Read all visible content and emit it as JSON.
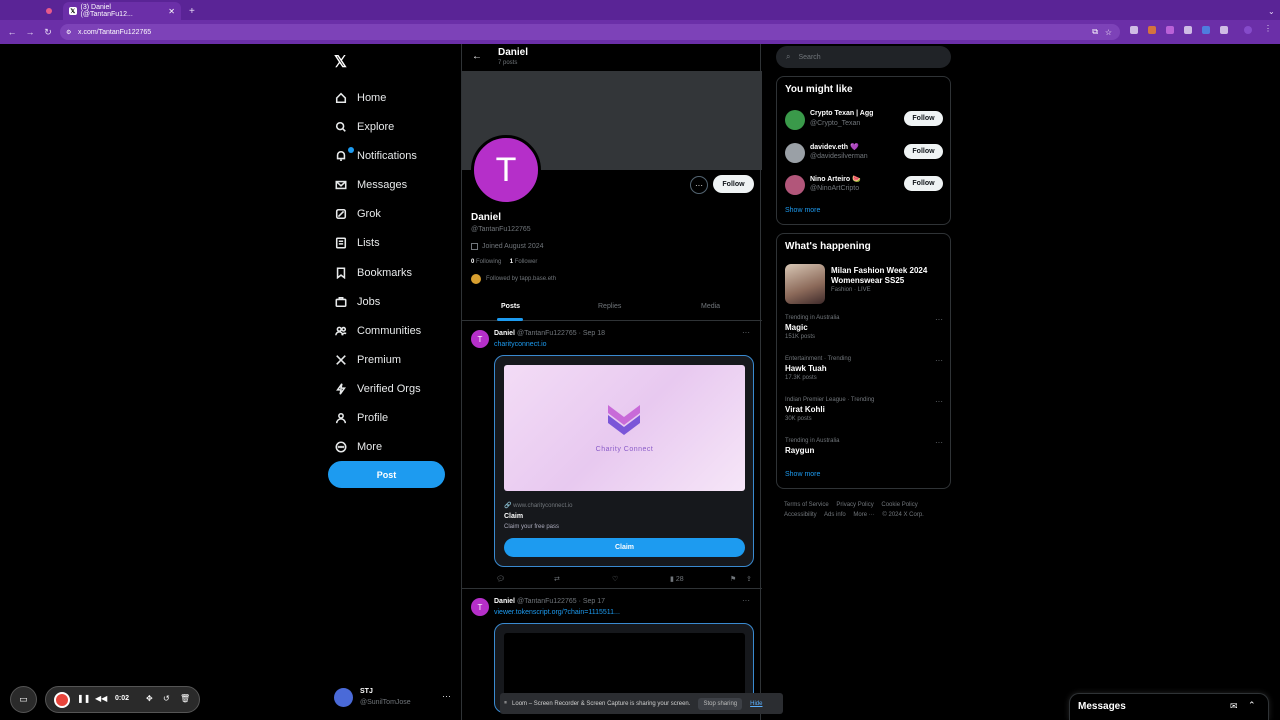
{
  "browser": {
    "tabs": [
      {
        "title": ""
      },
      {
        "title": "(3) Daniel (@TantanFu12..."
      }
    ],
    "url": "x.com/TantanFu122765"
  },
  "sidebar": {
    "items": [
      {
        "label": "Home",
        "icon": "home-icon"
      },
      {
        "label": "Explore",
        "icon": "search-icon"
      },
      {
        "label": "Notifications",
        "icon": "bell-icon"
      },
      {
        "label": "Messages",
        "icon": "mail-icon"
      },
      {
        "label": "Grok",
        "icon": "grok-icon"
      },
      {
        "label": "Lists",
        "icon": "list-icon"
      },
      {
        "label": "Bookmarks",
        "icon": "bookmark-icon"
      },
      {
        "label": "Jobs",
        "icon": "briefcase-icon"
      },
      {
        "label": "Communities",
        "icon": "people-icon"
      },
      {
        "label": "Premium",
        "icon": "x-logo-icon"
      },
      {
        "label": "Verified Orgs",
        "icon": "bolt-icon"
      },
      {
        "label": "Profile",
        "icon": "person-icon"
      },
      {
        "label": "More",
        "icon": "more-circle-icon"
      }
    ],
    "post_label": "Post",
    "account": {
      "name": "STJ",
      "handle": "@SunilTomJose"
    }
  },
  "profile": {
    "header_name": "Daniel",
    "post_count": "7 posts",
    "avatar_letter": "T",
    "follow_label": "Follow",
    "name": "Daniel",
    "handle": "@TantanFu122765",
    "joined": "Joined August 2024",
    "following_count": "0",
    "following_label": "Following",
    "followers_count": "1",
    "followers_label": "Follower",
    "followed_by": "Followed by tapp.base.eth",
    "tabs": [
      "Posts",
      "Replies",
      "Media"
    ]
  },
  "tweets": [
    {
      "avatar_letter": "T",
      "name": "Daniel",
      "meta": "@TantanFu122765 · Sep 18",
      "link": "charityconnect.io",
      "card": {
        "brand": "Charity Connect",
        "url": "www.charityconnect.io",
        "title": "Claim",
        "desc": "Claim your free pass",
        "button": "Claim"
      },
      "views": "28"
    },
    {
      "avatar_letter": "T",
      "name": "Daniel",
      "meta": "@TantanFu122765 · Sep 17",
      "link": "viewer.tokenscript.org/?chain=1115511..."
    }
  ],
  "right": {
    "search_placeholder": "Search",
    "you_might_like": {
      "title": "You might like",
      "users": [
        {
          "name": "Crypto Texan | Agg",
          "handle": "@Crypto_Texan",
          "follow": "Follow",
          "color": "#3a9a4a"
        },
        {
          "name": "davidev.eth 💜",
          "handle": "@davidesilverman",
          "follow": "Follow",
          "color": "#9aa0a6"
        },
        {
          "name": "Nino Arteiro 🍉",
          "handle": "@NinoArtCripto",
          "follow": "Follow",
          "color": "#b2567a"
        }
      ],
      "show_more": "Show more"
    },
    "happening": {
      "title": "What's happening",
      "feature": {
        "title": "Milan Fashion Week 2024 Womenswear SS25",
        "cat": "Fashion · LIVE"
      },
      "trends": [
        {
          "cat": "Trending in Australia",
          "title": "Magic",
          "posts": "151K posts"
        },
        {
          "cat": "Entertainment · Trending",
          "title": "Hawk Tuah",
          "posts": "17.3K posts"
        },
        {
          "cat": "Indian Premier League · Trending",
          "title": "Virat Kohli",
          "posts": "30K posts"
        },
        {
          "cat": "Trending in Australia",
          "title": "Raygun",
          "posts": ""
        }
      ],
      "show_more": "Show more"
    },
    "footer": [
      "Terms of Service",
      "Privacy Policy",
      "Cookie Policy",
      "Accessibility",
      "Ads info",
      "More ···",
      "© 2024 X Corp."
    ]
  },
  "loom": {
    "share_text": "Loom – Screen Recorder & Screen Capture is sharing your screen.",
    "stop_label": "Stop sharing",
    "hide_label": "Hide",
    "time": "0:02"
  },
  "messages_drawer": {
    "title": "Messages"
  },
  "colors": {
    "accent": "#1d9bf0",
    "browser": "#6b2fa8",
    "avatar": "#b52fc9"
  }
}
